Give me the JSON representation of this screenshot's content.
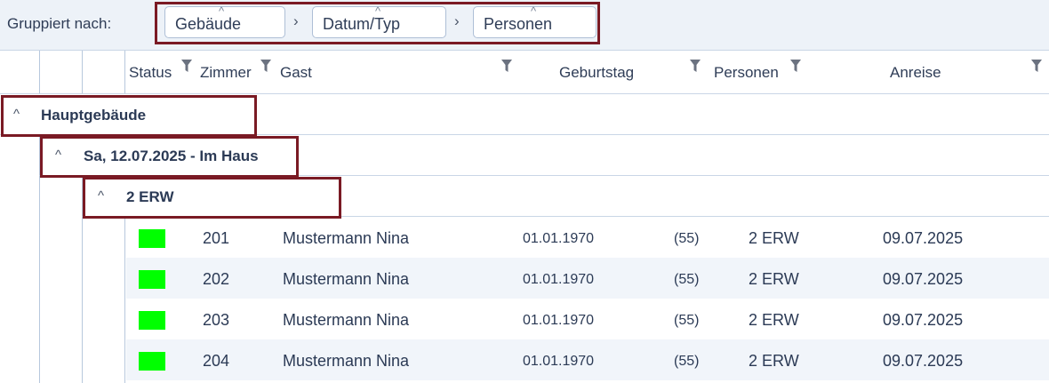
{
  "groupbar": {
    "label": "Gruppiert nach:",
    "chips": [
      {
        "label": "Gebäude"
      },
      {
        "label": "Datum/Typ"
      },
      {
        "label": "Personen"
      }
    ],
    "separator": "›",
    "caret": "^"
  },
  "columns": {
    "status": "Status",
    "zimmer": "Zimmer",
    "gast": "Gast",
    "geburtstag": "Geburtstag",
    "personen": "Personen",
    "anreise": "Anreise"
  },
  "groups": {
    "level1": {
      "label": "Hauptgebäude"
    },
    "level2": {
      "label": "Sa, 12.07.2025 - Im Haus"
    },
    "level3": {
      "label": "2 ERW"
    },
    "chevron": "^"
  },
  "rows": [
    {
      "status_color": "#00ff00",
      "zimmer": "201",
      "gast": "Mustermann Nina",
      "geburtstag": "01.01.1970",
      "alter": "(55)",
      "personen": "2 ERW",
      "anreise": "09.07.2025"
    },
    {
      "status_color": "#00ff00",
      "zimmer": "202",
      "gast": "Mustermann Nina",
      "geburtstag": "01.01.1970",
      "alter": "(55)",
      "personen": "2 ERW",
      "anreise": "09.07.2025"
    },
    {
      "status_color": "#00ff00",
      "zimmer": "203",
      "gast": "Mustermann Nina",
      "geburtstag": "01.01.1970",
      "alter": "(55)",
      "personen": "2 ERW",
      "anreise": "09.07.2025"
    },
    {
      "status_color": "#00ff00",
      "zimmer": "204",
      "gast": "Mustermann Nina",
      "geburtstag": "01.01.1970",
      "alter": "(55)",
      "personen": "2 ERW",
      "anreise": "09.07.2025"
    }
  ],
  "colors": {
    "highlight_border": "#7a1a24",
    "status_ok": "#00ff00",
    "row_alt": "#f1f5fa"
  }
}
